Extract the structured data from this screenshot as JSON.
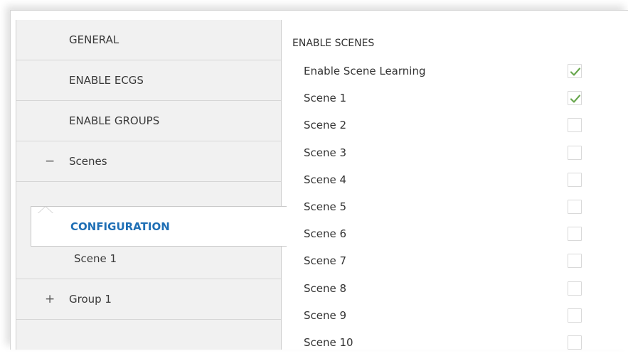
{
  "sidebar": {
    "items": [
      {
        "label": "GENERAL",
        "toggle": ""
      },
      {
        "label": "ENABLE ECGS",
        "toggle": ""
      },
      {
        "label": "ENABLE GROUPS",
        "toggle": ""
      },
      {
        "label": "Scenes",
        "toggle": "−"
      },
      {
        "label": "CONFIGURATION",
        "toggle": "",
        "selected": true
      },
      {
        "label": "Scene 1",
        "toggle": ""
      },
      {
        "label": "Group 1",
        "toggle": "+"
      }
    ]
  },
  "content": {
    "section_title": "ENABLE SCENES",
    "rows": [
      {
        "label": "Enable Scene Learning",
        "checked": true
      },
      {
        "label": "Scene 1",
        "checked": true
      },
      {
        "label": "Scene 2",
        "checked": false
      },
      {
        "label": "Scene 3",
        "checked": false
      },
      {
        "label": "Scene 4",
        "checked": false
      },
      {
        "label": "Scene 5",
        "checked": false
      },
      {
        "label": "Scene 6",
        "checked": false
      },
      {
        "label": "Scene 7",
        "checked": false
      },
      {
        "label": "Scene 8",
        "checked": false
      },
      {
        "label": "Scene 9",
        "checked": false
      },
      {
        "label": "Scene 10",
        "checked": false
      }
    ]
  },
  "colors": {
    "check": "#6aa84f",
    "selected_text": "#1f6fb5"
  }
}
